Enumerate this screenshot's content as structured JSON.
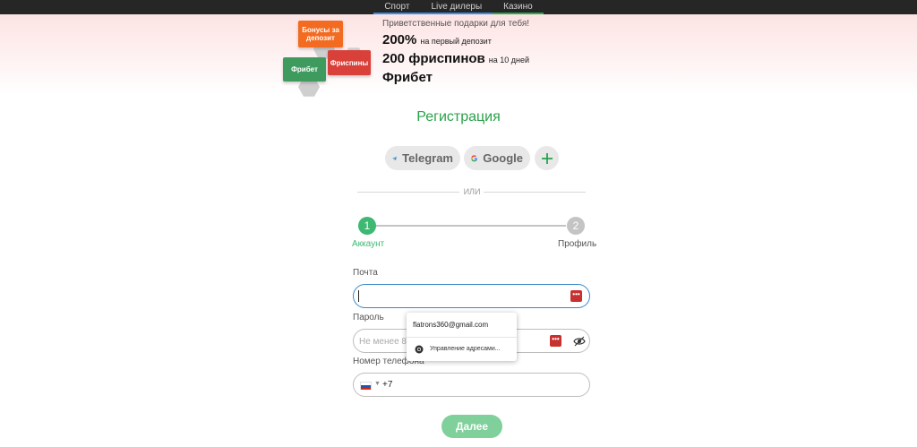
{
  "nav": {
    "tabs": [
      {
        "label": "Спорт"
      },
      {
        "label": "Live дилеры"
      },
      {
        "label": "Казино"
      }
    ]
  },
  "promo": {
    "badges": {
      "bonus": "Бонусы за депозит",
      "freebet": "Фрибет",
      "freespins": "Фриспины"
    },
    "subtitle": "Приветственные подарки для тебя!",
    "line1_big": "200%",
    "line1_small": "на первый депозит",
    "line2_big": "200 фриспинов",
    "line2_small": "на 10 дней",
    "line3_big": "Фрибет",
    "colors": {
      "bonus": "#f26b21",
      "freebet": "#3f9a5e",
      "freespins": "#d9403a"
    }
  },
  "registration": {
    "title": "Регистрация",
    "social": {
      "telegram": "Telegram",
      "google": "Google",
      "more_icon": "plus-icon"
    },
    "or_label": "ИЛИ",
    "steps": [
      {
        "number": "1",
        "label": "Аккаунт",
        "active": true
      },
      {
        "number": "2",
        "label": "Профиль",
        "active": false
      }
    ],
    "fields": {
      "email_label": "Почта",
      "email_value": "",
      "password_label": "Пароль",
      "password_placeholder": "Не менее 8 з",
      "phone_label": "Номер телефона",
      "phone_code": "+7"
    },
    "autofill": {
      "suggestion": "flatrons360@gmail.com",
      "manage": "Управление адресами..."
    },
    "submit_label": "Далее",
    "accent": "#2aa14a"
  }
}
